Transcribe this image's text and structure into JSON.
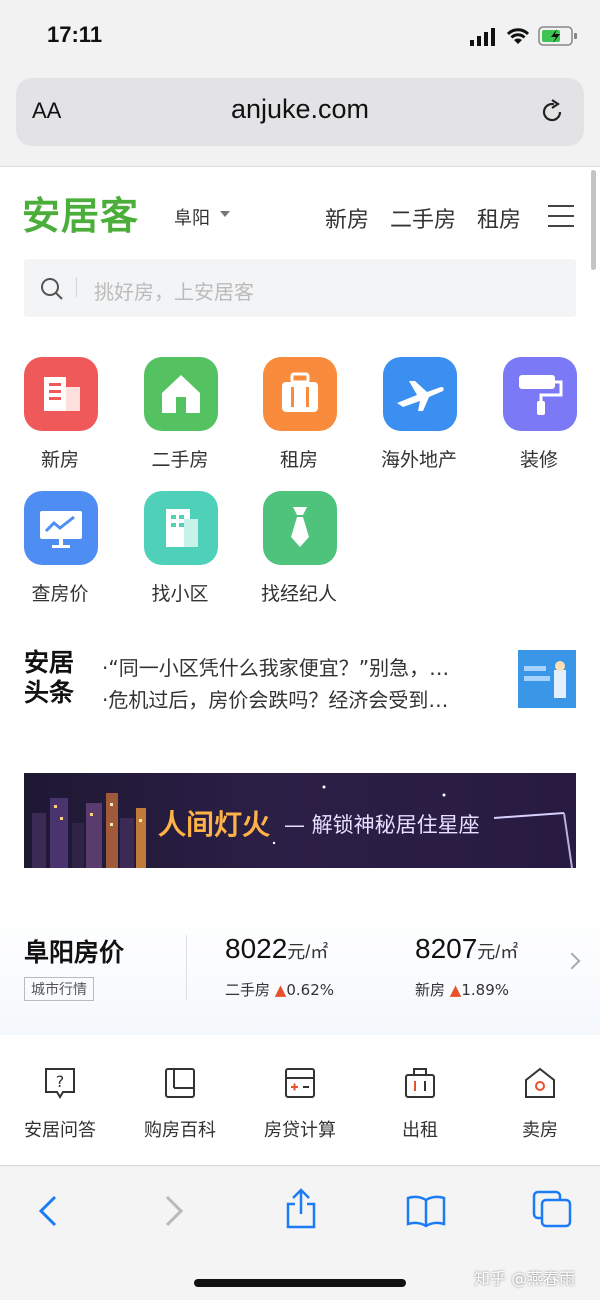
{
  "status": {
    "time": "17:11"
  },
  "browser": {
    "aa_label": "AA",
    "url": "anjuke.com"
  },
  "header": {
    "logo": "安居客",
    "city": "阜阳",
    "nav": [
      "新房",
      "二手房",
      "租房"
    ]
  },
  "search": {
    "placeholder": "挑好房，上安居客"
  },
  "categories": [
    {
      "label": "新房",
      "icon": "building-icon",
      "color": "#f0595a"
    },
    {
      "label": "二手房",
      "icon": "house-icon",
      "color": "#55c262"
    },
    {
      "label": "租房",
      "icon": "suitcase-icon",
      "color": "#f98c3c"
    },
    {
      "label": "海外地产",
      "icon": "airplane-icon",
      "color": "#3b8ff0"
    },
    {
      "label": "装修",
      "icon": "paint-roller-icon",
      "color": "#7b79f5"
    },
    {
      "label": "查房价",
      "icon": "price-chart-icon",
      "color": "#4e8ef2"
    },
    {
      "label": "找小区",
      "icon": "community-icon",
      "color": "#4fd0b8"
    },
    {
      "label": "找经纪人",
      "icon": "agent-tie-icon",
      "color": "#4fc27c"
    }
  ],
  "news": {
    "logo_line1": "安居",
    "logo_line2": "头条",
    "items": [
      "·“同一小区凭什么我家便宜？”别急，…",
      "·危机过后，房价会跌吗？经济会受到…"
    ]
  },
  "banner": {
    "title": "人间灯火",
    "subtitle": "— 解锁神秘居住星座"
  },
  "price": {
    "title": "阜阳房价",
    "tag": "城市行情",
    "second_hand": {
      "value": "8022",
      "unit": "元/㎡",
      "label": "二手房",
      "change": "0.62%"
    },
    "new_house": {
      "value": "8207",
      "unit": "元/㎡",
      "label": "新房",
      "change": "1.89%"
    }
  },
  "tools": [
    {
      "label": "安居问答",
      "icon": "question-icon"
    },
    {
      "label": "购房百科",
      "icon": "book-icon"
    },
    {
      "label": "房贷计算",
      "icon": "calculator-icon"
    },
    {
      "label": "出租",
      "icon": "rent-bag-icon"
    },
    {
      "label": "卖房",
      "icon": "sell-house-icon"
    }
  ],
  "watermark": "知乎 @燕春雨",
  "colors": {
    "brand_green": "#4cae3a",
    "ios_blue": "#1b7cf5",
    "up_red": "#e8522a"
  }
}
